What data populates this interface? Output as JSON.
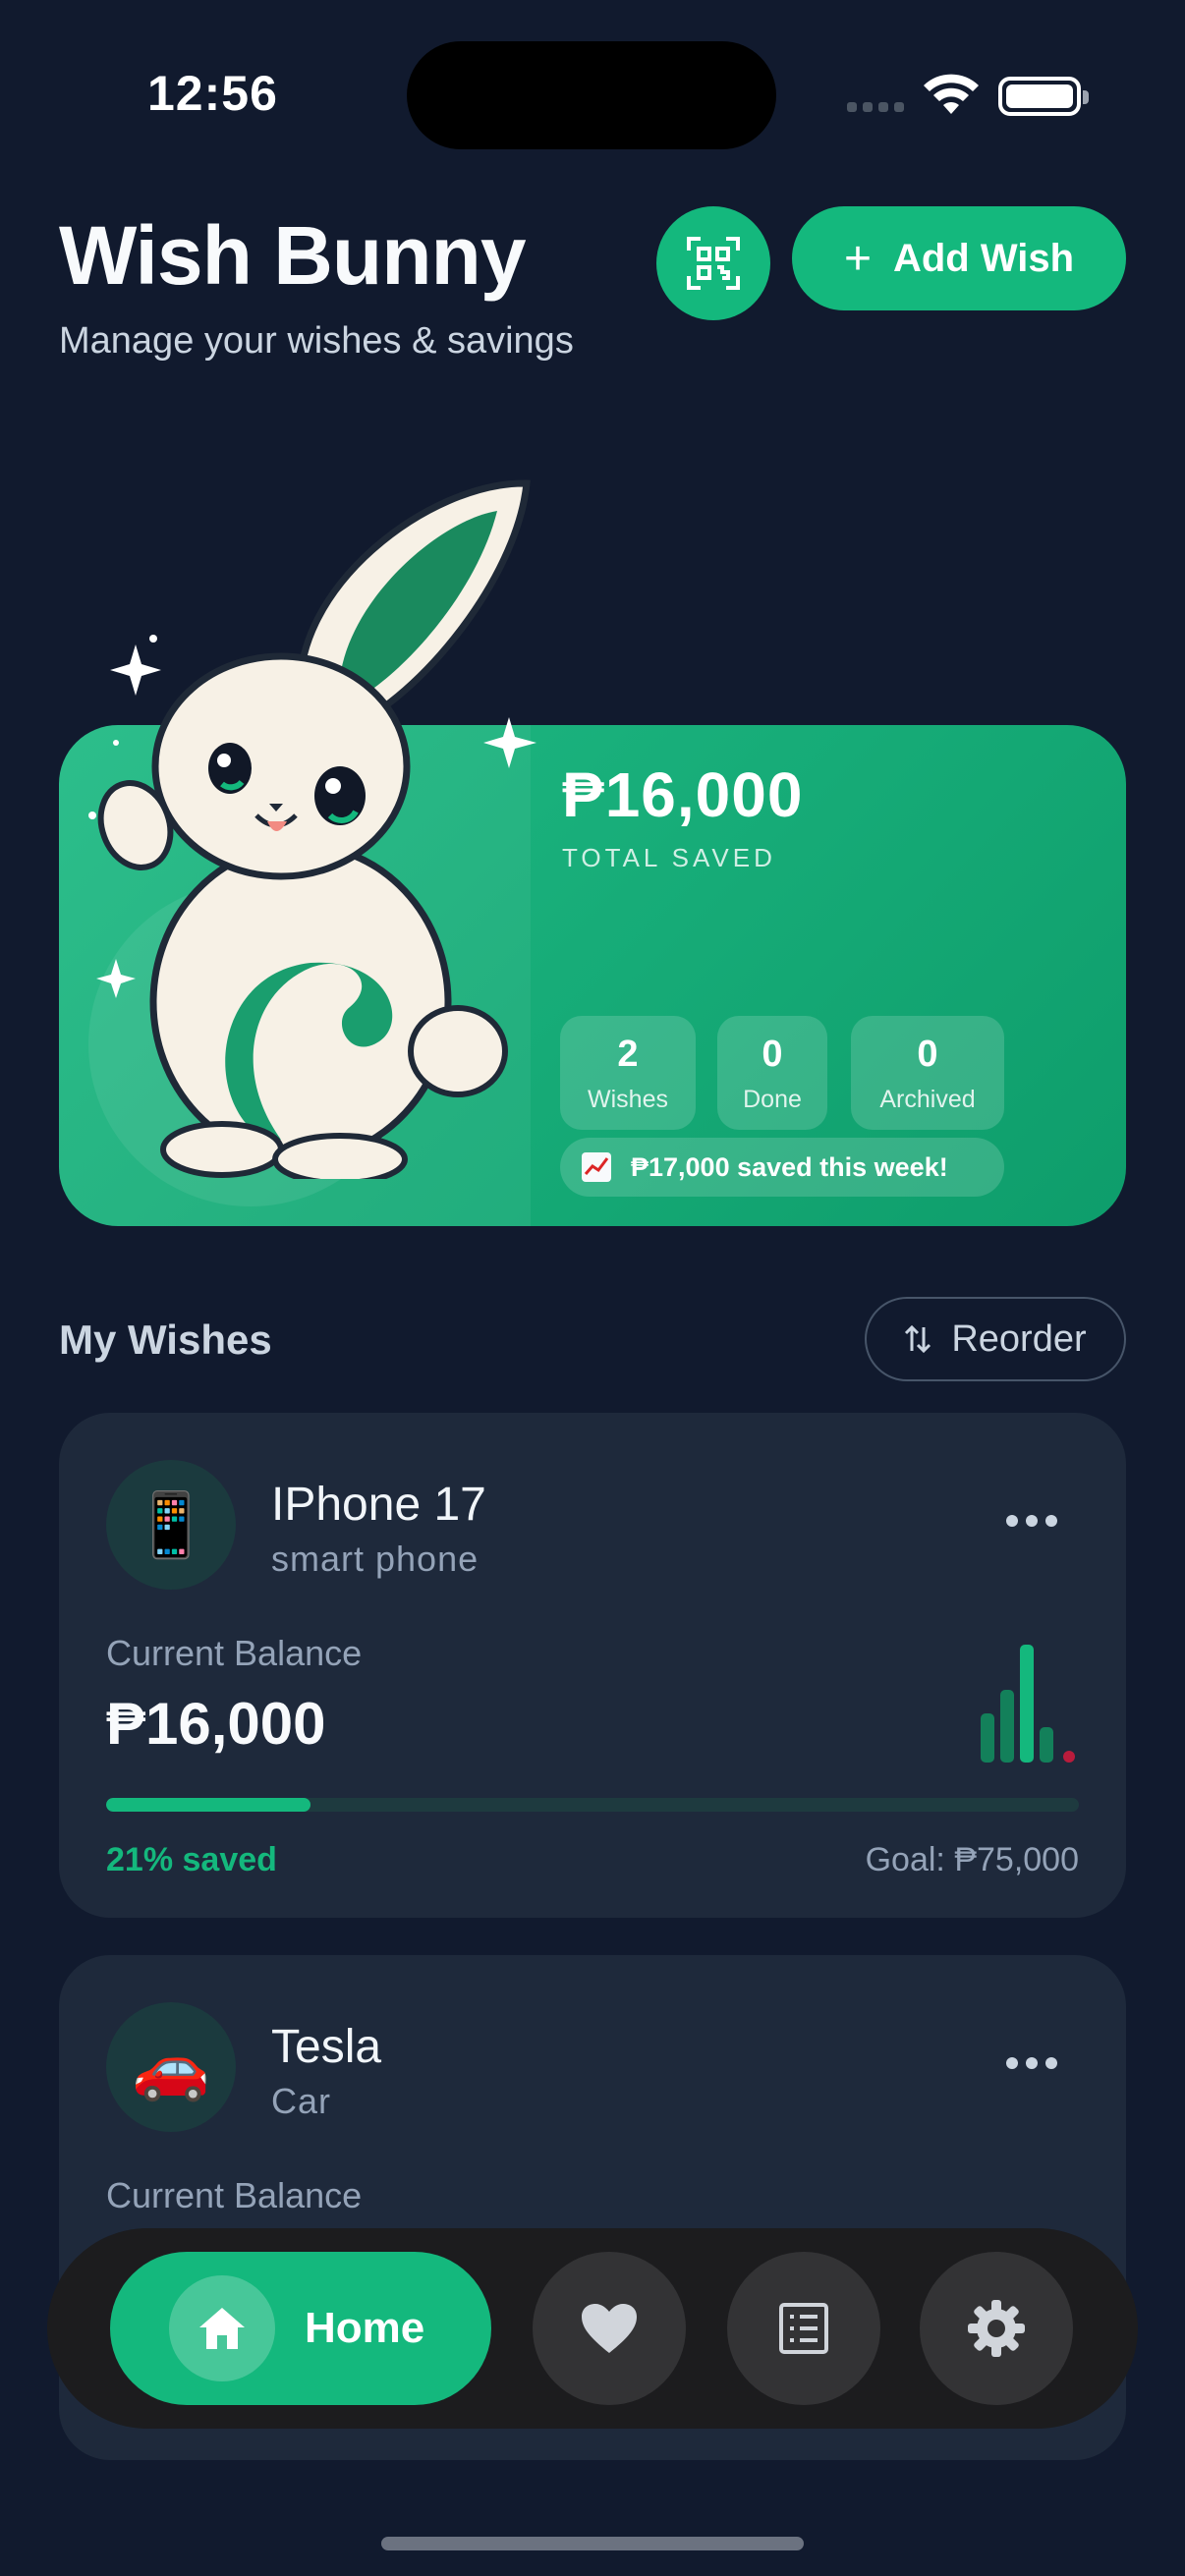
{
  "status_bar": {
    "time": "12:56"
  },
  "header": {
    "title": "Wish Bunny",
    "subtitle": "Manage your wishes & savings",
    "add_button_label": "Add Wish",
    "add_button_icon": "plus-icon",
    "scan_button_icon": "qr-scan-icon"
  },
  "hero": {
    "total_amount": "₱16,000",
    "total_label": "TOTAL SAVED",
    "stats": [
      {
        "value": "2",
        "label": "Wishes"
      },
      {
        "value": "0",
        "label": "Done"
      },
      {
        "value": "0",
        "label": "Archived"
      }
    ],
    "week_text": "₱17,000 saved this week!",
    "week_icon": "chart-increasing-icon",
    "mascot": "bunny-mascot"
  },
  "wishes_section": {
    "title": "My Wishes",
    "reorder_label": "Reorder",
    "reorder_icon": "sort-arrows-icon"
  },
  "wishes": [
    {
      "icon": "📱",
      "name": "IPhone 17",
      "category": "smart phone",
      "balance_label": "Current Balance",
      "balance": "₱16,000",
      "progress_fraction": 0.21,
      "progress_text": "21% saved",
      "goal_text": "Goal: ₱75,000"
    },
    {
      "icon": "🚗",
      "name": "Tesla",
      "category": "Car",
      "balance_label": "Current Balance"
    }
  ],
  "nav": {
    "home_label": "Home",
    "items": [
      "home-icon",
      "heart-icon",
      "list-icon",
      "gear-icon"
    ]
  },
  "colors": {
    "background": "#111a2e",
    "accent": "#14b87d",
    "card": "#1e293b"
  }
}
